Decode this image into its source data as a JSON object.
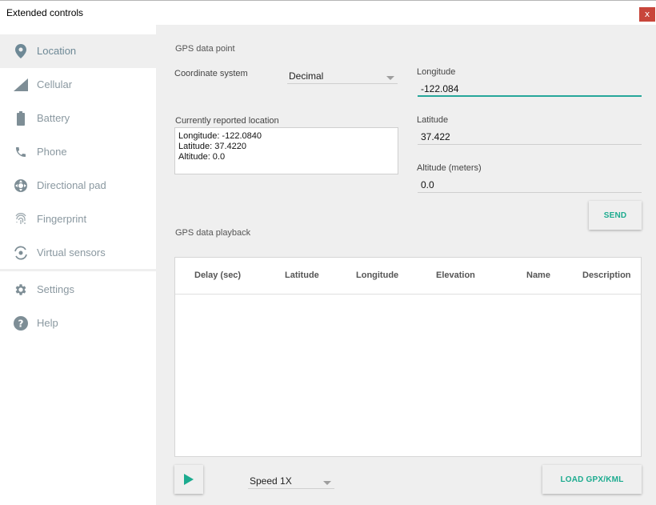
{
  "window": {
    "title": "Extended controls",
    "close_glyph": "x"
  },
  "sidebar": {
    "items": [
      {
        "label": "Location",
        "icon": "location-pin-icon",
        "active": true
      },
      {
        "label": "Cellular",
        "icon": "signal-icon"
      },
      {
        "label": "Battery",
        "icon": "battery-icon"
      },
      {
        "label": "Phone",
        "icon": "phone-icon"
      },
      {
        "label": "Directional pad",
        "icon": "dpad-icon"
      },
      {
        "label": "Fingerprint",
        "icon": "fingerprint-icon"
      },
      {
        "label": "Virtual sensors",
        "icon": "rotate-icon"
      },
      {
        "label": "Settings",
        "icon": "gear-icon"
      },
      {
        "label": "Help",
        "icon": "help-icon"
      }
    ]
  },
  "gps_point": {
    "title": "GPS data point",
    "coordinate_label": "Coordinate system",
    "coordinate_value": "Decimal",
    "location_label": "Currently reported location",
    "location_lines": [
      "Longitude: -122.0840",
      "Latitude: 37.4220",
      "Altitude: 0.0"
    ],
    "longitude_label": "Longitude",
    "longitude_value": "-122.084",
    "latitude_label": "Latitude",
    "latitude_value": "37.422",
    "altitude_label": "Altitude (meters)",
    "altitude_value": "0.0",
    "send_label": "SEND"
  },
  "playback": {
    "title": "GPS data playback",
    "columns": [
      "Delay (sec)",
      "Latitude",
      "Longitude",
      "Elevation",
      "Name",
      "Description"
    ],
    "speed_value": "Speed 1X",
    "load_label": "LOAD GPX/KML"
  },
  "colors": {
    "accent": "#26a69a",
    "close": "#c8463b",
    "icon": "#6e8996"
  }
}
